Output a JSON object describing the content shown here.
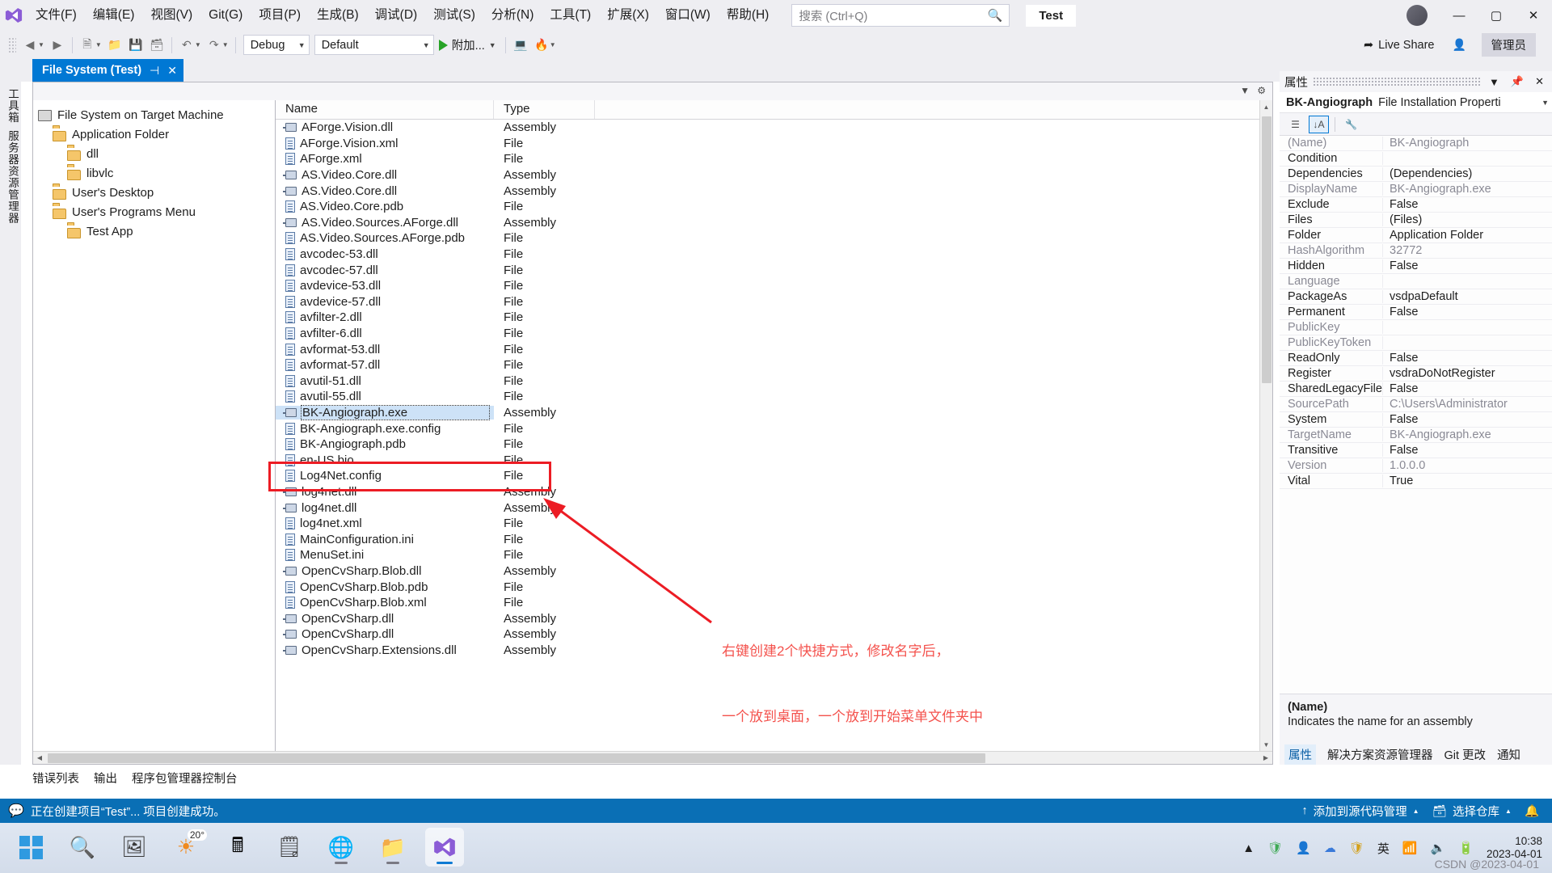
{
  "window": {
    "menu_items": [
      "文件(F)",
      "编辑(E)",
      "视图(V)",
      "Git(G)",
      "项目(P)",
      "生成(B)",
      "调试(D)",
      "测试(S)",
      "分析(N)",
      "工具(T)",
      "扩展(X)",
      "窗口(W)",
      "帮助(H)"
    ],
    "search_placeholder": "搜索 (Ctrl+Q)",
    "solution_name": "Test",
    "minimize": "—",
    "maximize": "▢",
    "close": "✕",
    "accent": "#0078d4"
  },
  "toolbar": {
    "config": "Debug",
    "platform": "Default",
    "run_label": "附加...",
    "live_share": "Live Share",
    "admin": "管理员"
  },
  "doc_tab": {
    "title": "File System (Test)",
    "pin": "⊣",
    "close": "✕"
  },
  "rail": {
    "toolbox": "工具箱",
    "server_explorer": "服务器资源管理器"
  },
  "tree": {
    "items": [
      {
        "label": "File System on Target Machine",
        "indent": 0,
        "icon": "computer-icon"
      },
      {
        "label": "Application Folder",
        "indent": 1,
        "icon": "folder-special-icon"
      },
      {
        "label": "dll",
        "indent": 2,
        "icon": "folder-icon"
      },
      {
        "label": "libvlc",
        "indent": 2,
        "icon": "folder-icon"
      },
      {
        "label": "User's Desktop",
        "indent": 1,
        "icon": "folder-special-icon"
      },
      {
        "label": "User's Programs Menu",
        "indent": 1,
        "icon": "folder-special-icon"
      },
      {
        "label": "Test App",
        "indent": 2,
        "icon": "folder-icon"
      }
    ]
  },
  "file_list": {
    "columns": [
      "Name",
      "Type"
    ],
    "rows": [
      {
        "name": "AForge.Vision.dll",
        "type": "Assembly",
        "icon": "assembly-icon"
      },
      {
        "name": "AForge.Vision.xml",
        "type": "File",
        "icon": "file-icon"
      },
      {
        "name": "AForge.xml",
        "type": "File",
        "icon": "file-icon"
      },
      {
        "name": "AS.Video.Core.dll",
        "type": "Assembly",
        "icon": "assembly-icon"
      },
      {
        "name": "AS.Video.Core.dll",
        "type": "Assembly",
        "icon": "assembly-icon"
      },
      {
        "name": "AS.Video.Core.pdb",
        "type": "File",
        "icon": "file-icon"
      },
      {
        "name": "AS.Video.Sources.AForge.dll",
        "type": "Assembly",
        "icon": "assembly-icon"
      },
      {
        "name": "AS.Video.Sources.AForge.pdb",
        "type": "File",
        "icon": "file-icon"
      },
      {
        "name": "avcodec-53.dll",
        "type": "File",
        "icon": "file-icon"
      },
      {
        "name": "avcodec-57.dll",
        "type": "File",
        "icon": "file-icon"
      },
      {
        "name": "avdevice-53.dll",
        "type": "File",
        "icon": "file-icon"
      },
      {
        "name": "avdevice-57.dll",
        "type": "File",
        "icon": "file-icon"
      },
      {
        "name": "avfilter-2.dll",
        "type": "File",
        "icon": "file-icon"
      },
      {
        "name": "avfilter-6.dll",
        "type": "File",
        "icon": "file-icon"
      },
      {
        "name": "avformat-53.dll",
        "type": "File",
        "icon": "file-icon"
      },
      {
        "name": "avformat-57.dll",
        "type": "File",
        "icon": "file-icon"
      },
      {
        "name": "avutil-51.dll",
        "type": "File",
        "icon": "file-icon"
      },
      {
        "name": "avutil-55.dll",
        "type": "File",
        "icon": "file-icon"
      },
      {
        "name": "BK-Angiograph.exe",
        "type": "Assembly",
        "icon": "assembly-icon",
        "selected": true
      },
      {
        "name": "BK-Angiograph.exe.config",
        "type": "File",
        "icon": "file-icon"
      },
      {
        "name": "BK-Angiograph.pdb",
        "type": "File",
        "icon": "file-icon"
      },
      {
        "name": "en-US.bio",
        "type": "File",
        "icon": "file-icon"
      },
      {
        "name": "Log4Net.config",
        "type": "File",
        "icon": "file-icon"
      },
      {
        "name": "log4net.dll",
        "type": "Assembly",
        "icon": "assembly-icon"
      },
      {
        "name": "log4net.dll",
        "type": "Assembly",
        "icon": "assembly-icon"
      },
      {
        "name": "log4net.xml",
        "type": "File",
        "icon": "file-icon"
      },
      {
        "name": "MainConfiguration.ini",
        "type": "File",
        "icon": "file-icon"
      },
      {
        "name": "MenuSet.ini",
        "type": "File",
        "icon": "file-icon"
      },
      {
        "name": "OpenCvSharp.Blob.dll",
        "type": "Assembly",
        "icon": "assembly-icon"
      },
      {
        "name": "OpenCvSharp.Blob.pdb",
        "type": "File",
        "icon": "file-icon"
      },
      {
        "name": "OpenCvSharp.Blob.xml",
        "type": "File",
        "icon": "file-icon"
      },
      {
        "name": "OpenCvSharp.dll",
        "type": "Assembly",
        "icon": "assembly-icon"
      },
      {
        "name": "OpenCvSharp.dll",
        "type": "Assembly",
        "icon": "assembly-icon"
      },
      {
        "name": "OpenCvSharp.Extensions.dll",
        "type": "Assembly",
        "icon": "assembly-icon"
      }
    ]
  },
  "annotation": {
    "color": "#ec1c24",
    "text_color": "#f4524d",
    "line1": "右键创建2个快捷方式，修改名字后，",
    "line2": "一个放到桌面，一个放到开始菜单文件夹中"
  },
  "properties": {
    "panel_title": "属性",
    "object_name": "BK-Angiograph",
    "object_type": "File Installation Properti",
    "rows": [
      {
        "key": "(Name)",
        "value": "BK-Angiograph",
        "readonly": true
      },
      {
        "key": "Condition",
        "value": "",
        "readonly": false
      },
      {
        "key": "Dependencies",
        "value": "(Dependencies)",
        "readonly": false
      },
      {
        "key": "DisplayName",
        "value": "BK-Angiograph.exe",
        "readonly": true
      },
      {
        "key": "Exclude",
        "value": "False",
        "readonly": false
      },
      {
        "key": "Files",
        "value": "(Files)",
        "readonly": false
      },
      {
        "key": "Folder",
        "value": "Application Folder",
        "readonly": false
      },
      {
        "key": "HashAlgorithm",
        "value": "32772",
        "readonly": true
      },
      {
        "key": "Hidden",
        "value": "False",
        "readonly": false
      },
      {
        "key": "Language",
        "value": "",
        "readonly": true
      },
      {
        "key": "PackageAs",
        "value": "vsdpaDefault",
        "readonly": false
      },
      {
        "key": "Permanent",
        "value": "False",
        "readonly": false
      },
      {
        "key": "PublicKey",
        "value": "",
        "readonly": true
      },
      {
        "key": "PublicKeyToken",
        "value": "",
        "readonly": true
      },
      {
        "key": "ReadOnly",
        "value": "False",
        "readonly": false
      },
      {
        "key": "Register",
        "value": "vsdraDoNotRegister",
        "readonly": false
      },
      {
        "key": "SharedLegacyFile",
        "value": "False",
        "readonly": false
      },
      {
        "key": "SourcePath",
        "value": "C:\\Users\\Administrator",
        "readonly": true
      },
      {
        "key": "System",
        "value": "False",
        "readonly": false
      },
      {
        "key": "TargetName",
        "value": "BK-Angiograph.exe",
        "readonly": true
      },
      {
        "key": "Transitive",
        "value": "False",
        "readonly": false
      },
      {
        "key": "Version",
        "value": "1.0.0.0",
        "readonly": true
      },
      {
        "key": "Vital",
        "value": "True",
        "readonly": false
      }
    ],
    "desc_title": "(Name)",
    "desc_body": "Indicates the name for an assembly",
    "tabs": [
      "属性",
      "解决方案资源管理器",
      "Git 更改",
      "通知"
    ]
  },
  "bottom_tabs": [
    "错误列表",
    "输出",
    "程序包管理器控制台"
  ],
  "status_bar": {
    "message": "正在创建项目“Test”... 项目创建成功。",
    "source_control": "添加到源代码管理",
    "repository": "选择仓库"
  },
  "taskbar": {
    "weather": "20°",
    "lang": "英",
    "time": "10:38",
    "date": "2023-04-01",
    "watermark": "CSDN @2023-04-01"
  }
}
